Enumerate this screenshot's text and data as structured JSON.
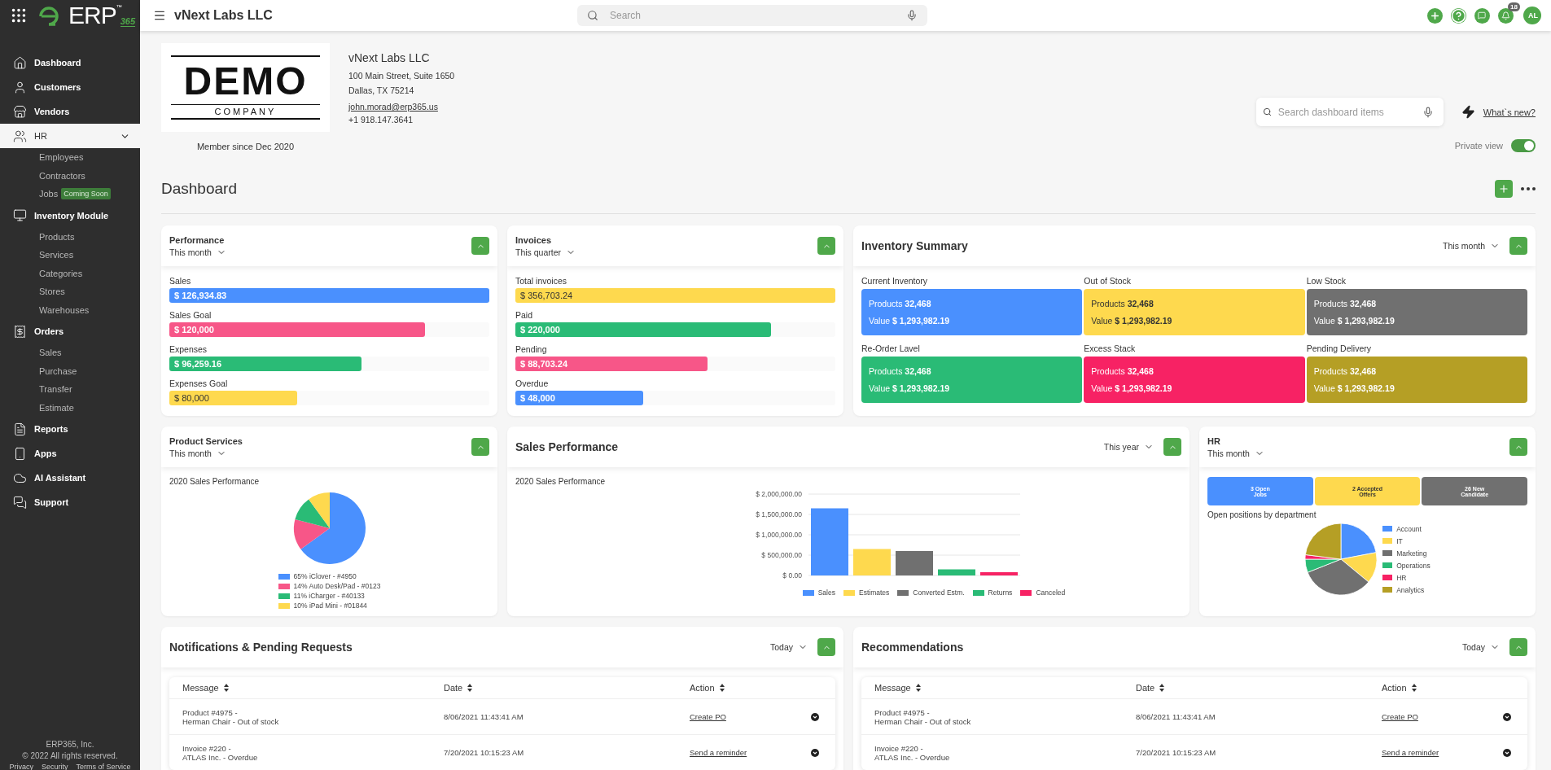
{
  "sidebar": {
    "logo": {
      "text": "ERP",
      "mark": "™",
      "suffix": "365"
    },
    "items": [
      {
        "label": "Dashboard",
        "selected": false
      },
      {
        "label": "Customers",
        "selected": false
      },
      {
        "label": "Vendors",
        "selected": false
      },
      {
        "label": "HR",
        "selected": true,
        "children": [
          {
            "label": "Employees"
          },
          {
            "label": "Contractors"
          },
          {
            "label": "Jobs",
            "badge": "Coming Soon"
          }
        ]
      },
      {
        "label": "Inventory Module",
        "selected": false,
        "children": [
          {
            "label": "Products"
          },
          {
            "label": "Services"
          },
          {
            "label": "Categories"
          },
          {
            "label": "Stores"
          },
          {
            "label": "Warehouses"
          }
        ]
      },
      {
        "label": "Orders",
        "selected": false,
        "children": [
          {
            "label": "Sales"
          },
          {
            "label": "Purchase"
          },
          {
            "label": "Transfer"
          },
          {
            "label": "Estimate"
          }
        ]
      },
      {
        "label": "Reports",
        "selected": false
      },
      {
        "label": "Apps",
        "selected": false
      },
      {
        "label": "AI Assistant",
        "selected": false
      },
      {
        "label": "Support",
        "selected": false
      }
    ],
    "footer": {
      "company": "ERP365, Inc.",
      "copyright": "© 2022 All rights reserved.",
      "links": [
        "Privacy",
        "Security",
        "Terms of Service"
      ]
    }
  },
  "topbar": {
    "title": "vNext Labs LLC",
    "search": {
      "placeholder": "Search"
    },
    "notifications": "18",
    "avatar": "AL"
  },
  "company": {
    "logo_word": "DEMO",
    "logo_subword": "COMPANY",
    "name": "vNext Labs LLC",
    "address": [
      "100 Main Street, Suite 1650",
      "Dallas, TX 75214"
    ],
    "email": "john.morad@erp365.us",
    "phone": "+1 918.147.3641",
    "member_since": "Member since Dec 2020"
  },
  "dashboard_search": {
    "placeholder": "Search dashboard items"
  },
  "whats_new": "What`s new?",
  "private_view": {
    "label": "Private view",
    "on": true
  },
  "dashboard": {
    "title": "Dashboard"
  },
  "performance": {
    "title": "Performance",
    "period": "This month",
    "bars": [
      {
        "label": "Sales",
        "value": "$ 126,934.83",
        "color": "#4a90fe",
        "level": 1
      },
      {
        "label": "Sales Goal",
        "value": "$ 120,000",
        "color": "#f75688",
        "level": 0.8
      },
      {
        "label": "Expenses",
        "value": "$ 96,259.16",
        "color": "#2abb76",
        "level": 0.6
      },
      {
        "label": "Expenses Goal",
        "value": "$ 80,000",
        "color": "#fed94e",
        "level": 0.4
      }
    ]
  },
  "invoices": {
    "title": "Invoices",
    "period": "This quarter",
    "bars": [
      {
        "label": "Total invoices",
        "value": "$ 356,703.24",
        "color": "#fed94e",
        "level": 1
      },
      {
        "label": "Paid",
        "value": "$ 220,000",
        "color": "#2abb76",
        "level": 0.8
      },
      {
        "label": "Pending",
        "value": "$ 88,703.24",
        "color": "#f75688",
        "level": 0.6
      },
      {
        "label": "Overdue",
        "value": "$ 48,000",
        "color": "#4a90fe",
        "level": 0.4
      }
    ]
  },
  "inventory": {
    "title": "Inventory Summary",
    "period": "This month",
    "tiles": [
      {
        "label": "Current Inventory",
        "products": "Products **32,468**",
        "value": "Value **$ 1,293,982.19**",
        "color": "#4a90fe"
      },
      {
        "label": "Out of Stock",
        "products": "Products **32,468**",
        "value": "Value **$ 1,293,982.19**",
        "color": "#fed94e"
      },
      {
        "label": "Low Stock",
        "products": "Products **32,468**",
        "value": "Value **$ 1,293,982.19**",
        "color": "#707070"
      },
      {
        "label": "Re-Order Lavel",
        "products": "Products **32,468**",
        "value": "Value **$ 1,293,982.19**",
        "color": "#2abb76"
      },
      {
        "label": "Excess Stack",
        "products": "Products **32,468**",
        "value": "Value **$ 1,293,982.19**",
        "color": "#f72264"
      },
      {
        "label": "Pending Delivery",
        "products": "Products **32,468**",
        "value": "Value **$ 1,293,982.19**",
        "color": "#b59f25"
      }
    ]
  },
  "product_services": {
    "title": "Product Services",
    "period": "This month",
    "chart_data": {
      "type": "pie",
      "title": "2020 Sales Performance",
      "categories": [
        "65% iClover - #4950",
        "14% Auto Desk/Pad - #0123",
        "11% iCharger - #40133",
        "10% iPad Mini - #01844"
      ],
      "values": [
        65,
        14,
        11,
        10
      ],
      "colors": [
        "#4a90fe",
        "#f75688",
        "#2abb76",
        "#fed94e"
      ]
    }
  },
  "sales_performance": {
    "title": "Sales Performance",
    "period": "This year",
    "chart_data": {
      "type": "bar",
      "title": "2020 Sales Performance",
      "grid": true,
      "ylim": [
        0,
        2000000
      ],
      "yticks": [
        {
          "value": 0,
          "label": "$ 0.00"
        },
        {
          "value": 500000,
          "label": "$ 500,000.00"
        },
        {
          "value": 1000000,
          "label": "$ 1,000,000.00"
        },
        {
          "value": 1500000,
          "label": "$ 1,500,000.00"
        },
        {
          "value": 2000000,
          "label": "$ 2,000,000.00"
        }
      ],
      "series": [
        {
          "name": "Sales",
          "color": "#4a90fe",
          "values": [
            1650000
          ]
        },
        {
          "name": "Estimates",
          "color": "#fed94e",
          "values": [
            650000
          ]
        },
        {
          "name": "Converted Estm.",
          "color": "#707070",
          "values": [
            600000
          ]
        },
        {
          "name": "Returns",
          "color": "#2abb76",
          "values": [
            150000
          ]
        },
        {
          "name": "Canceled",
          "color": "#f72264",
          "values": [
            80000
          ]
        }
      ]
    }
  },
  "hr": {
    "title": "HR",
    "period": "This month",
    "tiles": [
      {
        "text": "3 Open\nJobs",
        "color": "#4a90fe"
      },
      {
        "text": "2 Accepted\nOffers",
        "color": "#fed94e"
      },
      {
        "text": "26 New\nCandidate",
        "color": "#707070"
      }
    ],
    "subtitle": "Open positions by department",
    "legend": [
      {
        "label": "Account",
        "color": "#4a90fe"
      },
      {
        "label": "IT",
        "color": "#fed94e"
      },
      {
        "label": "Marketing",
        "color": "#707070"
      },
      {
        "label": "Operations",
        "color": "#2abb76"
      },
      {
        "label": "HR",
        "color": "#f72264"
      },
      {
        "label": "Analytics",
        "color": "#b59f25"
      }
    ]
  },
  "notifications": {
    "title": "Notifications & Pending Requests",
    "period": "Today",
    "columns": [
      "Message",
      "Date",
      "Action"
    ],
    "rows": [
      {
        "message": "Product #4975 -\nHerman Chair - Out of stock",
        "date": "8/06/2021 11:43:41 AM",
        "action": "Create PO"
      },
      {
        "message": "Invoice #220 -\nATLAS Inc. - Overdue",
        "date": "7/20/2021 10:15:23 AM",
        "action": "Send a reminder"
      }
    ]
  },
  "recommendations": {
    "title": "Recommendations",
    "period": "Today",
    "columns": [
      "Message",
      "Date",
      "Action"
    ],
    "rows": [
      {
        "message": "Product #4975 -\nHerman Chair - Out of stock",
        "date": "8/06/2021 11:43:41 AM",
        "action": "Create PO"
      },
      {
        "message": "Invoice #220 -\nATLAS Inc. - Overdue",
        "date": "7/20/2021 10:15:23 AM",
        "action": "Send a reminder"
      }
    ]
  }
}
